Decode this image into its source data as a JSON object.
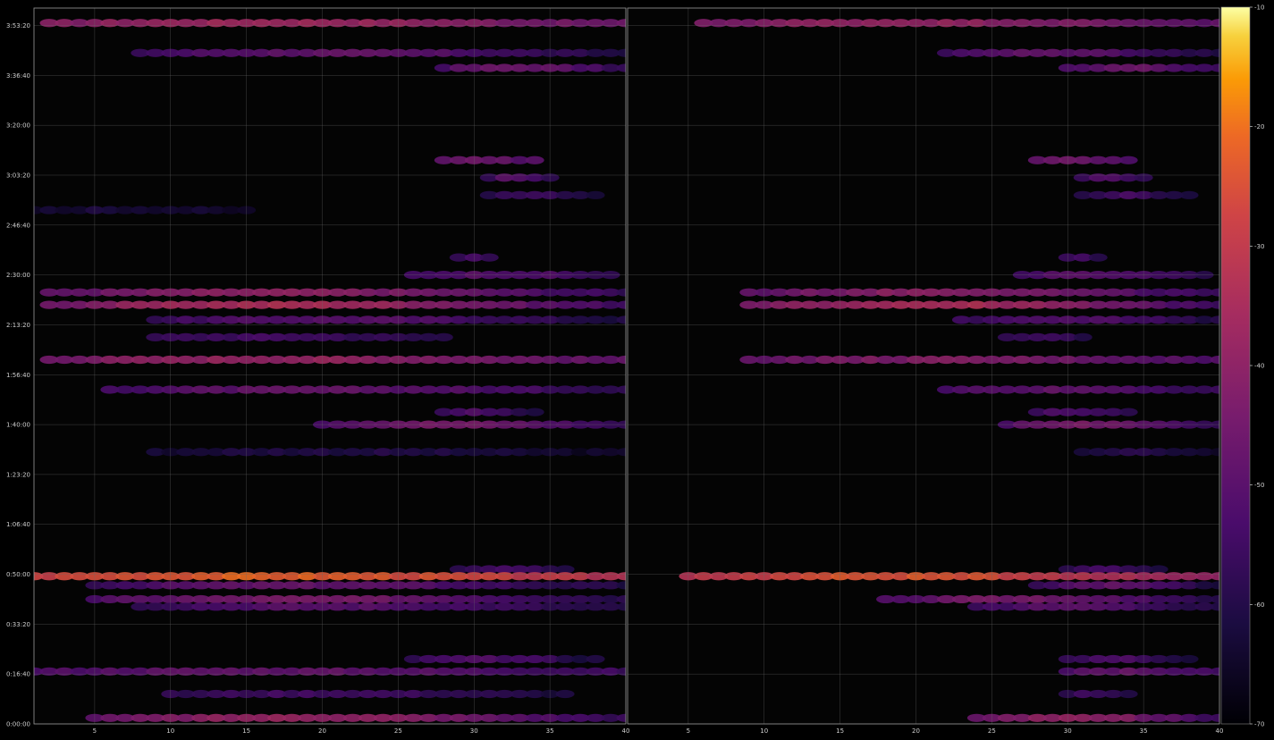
{
  "chart_data": {
    "type": "heatmap",
    "panels": [
      {
        "name": "left",
        "x_range": [
          1,
          40
        ],
        "x_ticks": [
          "5",
          "10",
          "15",
          "20",
          "25",
          "30",
          "35",
          "40"
        ],
        "y_range": [
          0,
          14350
        ],
        "y_ticks": [
          "0:00:00",
          "0:16:40",
          "0:33:20",
          "0:50:00",
          "1:06:40",
          "1:23:20",
          "1:40:00",
          "1:56:40",
          "2:13:20",
          "2:30:00",
          "2:46:40",
          "3:03:20",
          "3:20:00",
          "3:36:40",
          "3:53:20"
        ],
        "rows": [
          {
            "t": 14050,
            "x": [
              2,
              40
            ],
            "db": [
              -48,
              -36
            ]
          },
          {
            "t": 13450,
            "x": [
              8,
              40
            ],
            "db": [
              -62,
              -48
            ]
          },
          {
            "t": 13150,
            "x": [
              28,
              40
            ],
            "db": [
              -58,
              -46
            ]
          },
          {
            "t": 11300,
            "x": [
              28,
              34
            ],
            "db": [
              -52,
              -46
            ]
          },
          {
            "t": 10950,
            "x": [
              31,
              35
            ],
            "db": [
              -60,
              -50
            ]
          },
          {
            "t": 10600,
            "x": [
              31,
              38
            ],
            "db": [
              -62,
              -54
            ]
          },
          {
            "t": 10300,
            "x": [
              1,
              15
            ],
            "db": [
              -66,
              -62
            ]
          },
          {
            "t": 9350,
            "x": [
              29,
              31
            ],
            "db": [
              -58,
              -54
            ]
          },
          {
            "t": 9000,
            "x": [
              26,
              39
            ],
            "db": [
              -58,
              -50
            ]
          },
          {
            "t": 8650,
            "x": [
              2,
              40
            ],
            "db": [
              -58,
              -40
            ]
          },
          {
            "t": 8400,
            "x": [
              2,
              40
            ],
            "db": [
              -56,
              -34
            ]
          },
          {
            "t": 8100,
            "x": [
              9,
              40
            ],
            "db": [
              -62,
              -50
            ]
          },
          {
            "t": 7750,
            "x": [
              9,
              28
            ],
            "db": [
              -60,
              -54
            ]
          },
          {
            "t": 7300,
            "x": [
              2,
              40
            ],
            "db": [
              -50,
              -38
            ]
          },
          {
            "t": 6700,
            "x": [
              6,
              40
            ],
            "db": [
              -58,
              -48
            ]
          },
          {
            "t": 6250,
            "x": [
              28,
              34
            ],
            "db": [
              -60,
              -52
            ]
          },
          {
            "t": 6000,
            "x": [
              20,
              40
            ],
            "db": [
              -58,
              -44
            ]
          },
          {
            "t": 5450,
            "x": [
              9,
              40
            ],
            "db": [
              -66,
              -60
            ]
          },
          {
            "t": 3100,
            "x": [
              29,
              36
            ],
            "db": [
              -60,
              -54
            ]
          },
          {
            "t": 2960,
            "x": [
              1,
              40
            ],
            "db": [
              -34,
              -22
            ]
          },
          {
            "t": 2780,
            "x": [
              5,
              40
            ],
            "db": [
              -62,
              -48
            ]
          },
          {
            "t": 2500,
            "x": [
              5,
              40
            ],
            "db": [
              -60,
              -44
            ]
          },
          {
            "t": 2350,
            "x": [
              8,
              40
            ],
            "db": [
              -62,
              -50
            ]
          },
          {
            "t": 1300,
            "x": [
              26,
              38
            ],
            "db": [
              -62,
              -52
            ]
          },
          {
            "t": 1050,
            "x": [
              1,
              40
            ],
            "db": [
              -56,
              -48
            ]
          },
          {
            "t": 600,
            "x": [
              10,
              36
            ],
            "db": [
              -62,
              -54
            ]
          },
          {
            "t": 120,
            "x": [
              5,
              40
            ],
            "db": [
              -58,
              -38
            ]
          }
        ]
      },
      {
        "name": "right",
        "x_range": [
          1,
          40
        ],
        "x_ticks": [
          "5",
          "10",
          "15",
          "20",
          "25",
          "30",
          "35",
          "40"
        ],
        "y_range": [
          0,
          14350
        ],
        "rows": [
          {
            "t": 14050,
            "x": [
              6,
              40
            ],
            "db": [
              -50,
              -38
            ]
          },
          {
            "t": 13450,
            "x": [
              22,
              40
            ],
            "db": [
              -62,
              -48
            ]
          },
          {
            "t": 13150,
            "x": [
              30,
              40
            ],
            "db": [
              -58,
              -46
            ]
          },
          {
            "t": 11300,
            "x": [
              28,
              34
            ],
            "db": [
              -52,
              -46
            ]
          },
          {
            "t": 10950,
            "x": [
              31,
              35
            ],
            "db": [
              -60,
              -50
            ]
          },
          {
            "t": 10600,
            "x": [
              31,
              38
            ],
            "db": [
              -62,
              -54
            ]
          },
          {
            "t": 9350,
            "x": [
              30,
              32
            ],
            "db": [
              -58,
              -54
            ]
          },
          {
            "t": 9000,
            "x": [
              27,
              39
            ],
            "db": [
              -58,
              -50
            ]
          },
          {
            "t": 8650,
            "x": [
              9,
              40
            ],
            "db": [
              -58,
              -40
            ]
          },
          {
            "t": 8400,
            "x": [
              9,
              40
            ],
            "db": [
              -56,
              -34
            ]
          },
          {
            "t": 8100,
            "x": [
              23,
              40
            ],
            "db": [
              -62,
              -50
            ]
          },
          {
            "t": 7750,
            "x": [
              26,
              31
            ],
            "db": [
              -60,
              -54
            ]
          },
          {
            "t": 7300,
            "x": [
              9,
              40
            ],
            "db": [
              -52,
              -42
            ]
          },
          {
            "t": 6700,
            "x": [
              22,
              40
            ],
            "db": [
              -58,
              -48
            ]
          },
          {
            "t": 6250,
            "x": [
              28,
              34
            ],
            "db": [
              -60,
              -52
            ]
          },
          {
            "t": 6000,
            "x": [
              26,
              40
            ],
            "db": [
              -58,
              -44
            ]
          },
          {
            "t": 5450,
            "x": [
              31,
              40
            ],
            "db": [
              -66,
              -60
            ]
          },
          {
            "t": 3100,
            "x": [
              30,
              36
            ],
            "db": [
              -60,
              -54
            ]
          },
          {
            "t": 2960,
            "x": [
              5,
              40
            ],
            "db": [
              -40,
              -24
            ]
          },
          {
            "t": 2780,
            "x": [
              28,
              40
            ],
            "db": [
              -62,
              -48
            ]
          },
          {
            "t": 2500,
            "x": [
              18,
              40
            ],
            "db": [
              -60,
              -44
            ]
          },
          {
            "t": 2350,
            "x": [
              24,
              40
            ],
            "db": [
              -62,
              -50
            ]
          },
          {
            "t": 1300,
            "x": [
              30,
              38
            ],
            "db": [
              -62,
              -52
            ]
          },
          {
            "t": 1050,
            "x": [
              30,
              40
            ],
            "db": [
              -56,
              -48
            ]
          },
          {
            "t": 600,
            "x": [
              30,
              34
            ],
            "db": [
              -62,
              -54
            ]
          },
          {
            "t": 120,
            "x": [
              24,
              40
            ],
            "db": [
              -58,
              -38
            ]
          }
        ]
      }
    ],
    "colorbar": {
      "range": [
        -70,
        -10
      ],
      "ticks": [
        "-10",
        "-20",
        "-30",
        "-40",
        "-50",
        "-60",
        "-70"
      ],
      "colormap": "inferno"
    },
    "grid": true,
    "background": "#000000",
    "grid_color": "#6b6b6b"
  }
}
